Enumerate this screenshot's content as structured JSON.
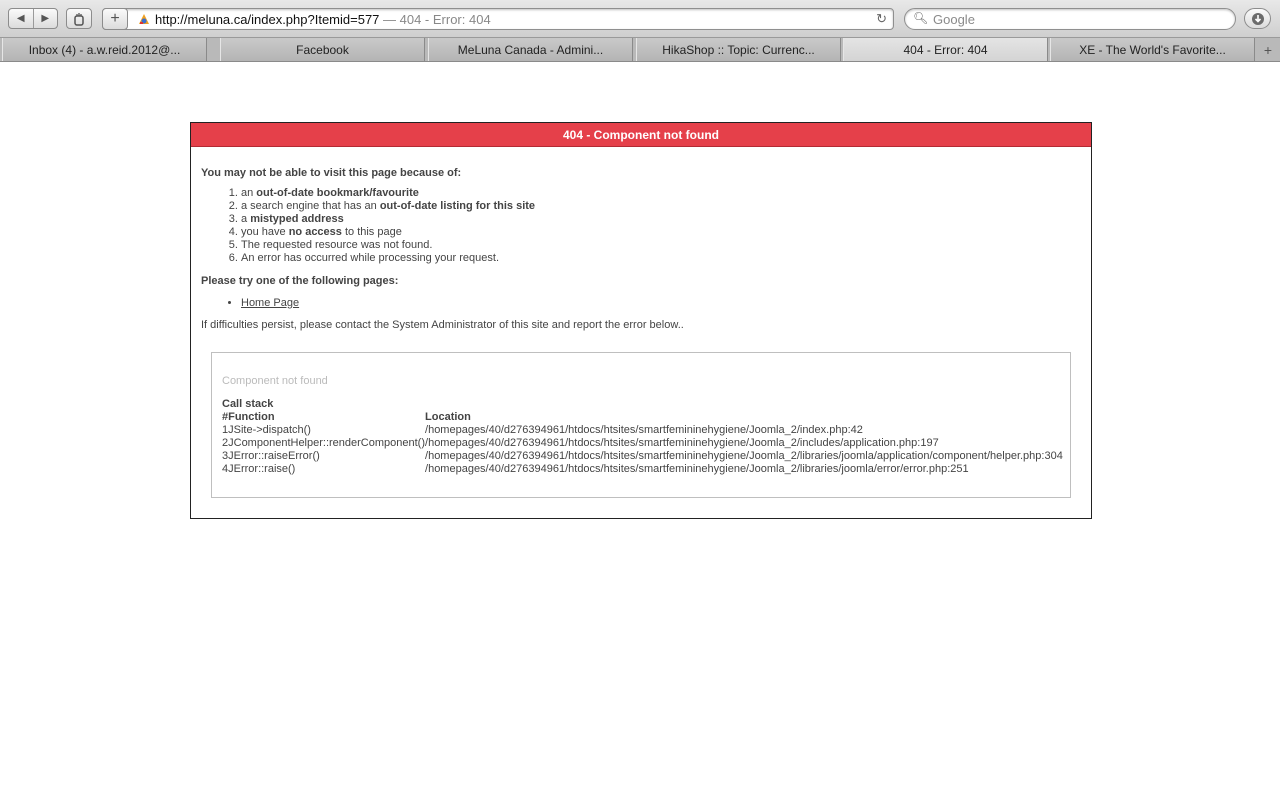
{
  "browser": {
    "url": "http://meluna.ca/index.php?Itemid=577",
    "title_suffix": " — 404 - Error: 404",
    "search_placeholder": "Google",
    "tabs": [
      {
        "label": "Inbox (4) - a.w.reid.2012@..."
      },
      {
        "label": "Facebook"
      },
      {
        "label": "MeLuna Canada - Admini..."
      },
      {
        "label": "HikaShop :: Topic: Currenc..."
      },
      {
        "label": "404 - Error: 404"
      },
      {
        "label": "XE - The World's Favorite..."
      }
    ],
    "active_tab_index": 4
  },
  "error": {
    "header": "404 - Component not found",
    "reasons_intro": "You may not be able to visit this page because of:",
    "reasons": [
      {
        "pre": "an ",
        "bold": "out-of-date bookmark/favourite",
        "post": ""
      },
      {
        "pre": "a search engine that has an ",
        "bold": "out-of-date listing for this site",
        "post": ""
      },
      {
        "pre": "a ",
        "bold": "mistyped address",
        "post": ""
      },
      {
        "pre": "you have ",
        "bold": "no access",
        "post": " to this page"
      },
      {
        "pre": "The requested resource was not found.",
        "bold": "",
        "post": ""
      },
      {
        "pre": "An error has occurred while processing your request.",
        "bold": "",
        "post": ""
      }
    ],
    "pages_intro": "Please try one of the following pages:",
    "pages": [
      {
        "label": "Home Page"
      }
    ],
    "contact_text": "If difficulties persist, please contact the System Administrator of this site and report the error below..",
    "detail_message": "Component not found",
    "call_stack_caption": "Call stack",
    "columns": [
      "#Function",
      "Location"
    ],
    "stack": [
      {
        "num": "1",
        "fn": "JSite->dispatch()",
        "loc": "/homepages/40/d276394961/htdocs/htsites/smartfemininehygiene/Joomla_2/index.php:42"
      },
      {
        "num": "2",
        "fn": "JComponentHelper::renderComponent()",
        "loc": "/homepages/40/d276394961/htdocs/htsites/smartfemininehygiene/Joomla_2/includes/application.php:197"
      },
      {
        "num": "3",
        "fn": "JError::raiseError()",
        "loc": "/homepages/40/d276394961/htdocs/htsites/smartfemininehygiene/Joomla_2/libraries/joomla/application/component/helper.php:304"
      },
      {
        "num": "4",
        "fn": "JError::raise()",
        "loc": "/homepages/40/d276394961/htdocs/htsites/smartfemininehygiene/Joomla_2/libraries/joomla/error/error.php:251"
      }
    ]
  }
}
